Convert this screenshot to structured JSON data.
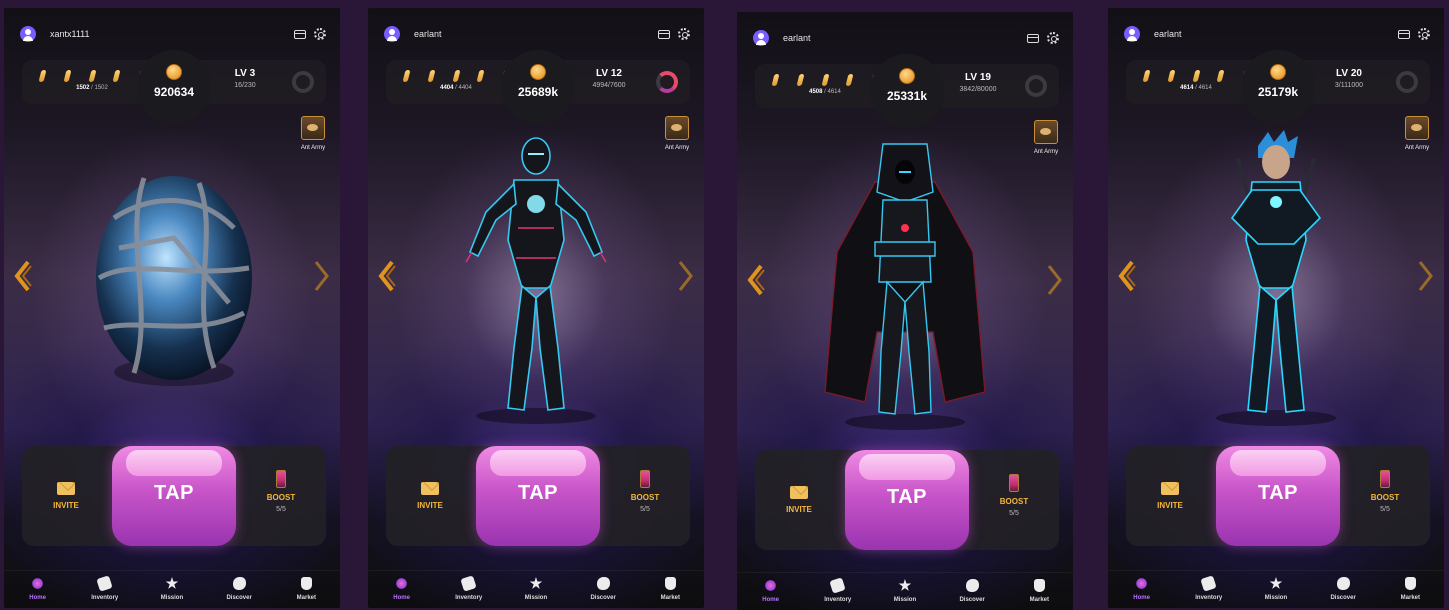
{
  "nav_items": [
    "Home",
    "Inventory",
    "Mission",
    "Discover",
    "Market"
  ],
  "action": {
    "invite_label": "INVITE",
    "tap_label": "TAP",
    "boost_label": "BOOST",
    "boost_count": "5/5"
  },
  "army_label": "Ant Army",
  "colors": {
    "accent": "#f5b73a",
    "tap_pink": "#c754c8",
    "nav_active": "#b874ff",
    "background": "#2a1738"
  },
  "screens": [
    {
      "username": "xantx1111",
      "energy_current": "1502",
      "energy_max": "1502",
      "coins": "920634",
      "level": "LV 3",
      "xp": "16/230",
      "xp_progress": 0.07,
      "character": "crystal-egg"
    },
    {
      "username": "earlant",
      "energy_current": "4404",
      "energy_max": "4404",
      "coins": "25689k",
      "level": "LV 12",
      "xp": "4994/7600",
      "xp_progress": 0.66,
      "character": "neon-cyber-hero"
    },
    {
      "username": "earlant",
      "energy_current": "4508",
      "energy_max": "4614",
      "coins": "25331k",
      "level": "LV 19",
      "xp": "3842/80000",
      "xp_progress": 0.05,
      "character": "hooded-caped-hero"
    },
    {
      "username": "earlant",
      "energy_current": "4614",
      "energy_max": "4614",
      "coins": "25179k",
      "level": "LV 20",
      "xp": "3/111000",
      "xp_progress": 0.0,
      "character": "blue-hair-ninja-hero"
    }
  ]
}
